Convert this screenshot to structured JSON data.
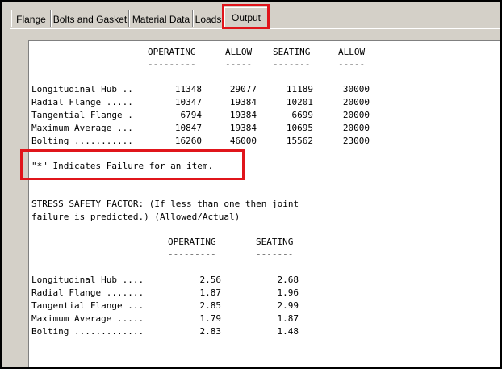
{
  "tabs": [
    {
      "label": "Flange",
      "active": false
    },
    {
      "label": "Bolts and Gasket",
      "active": false
    },
    {
      "label": "Material Data",
      "active": false
    },
    {
      "label": "Loads",
      "active": false
    },
    {
      "label": "Output",
      "active": true
    }
  ],
  "stress_table": {
    "headers": {
      "operating": "OPERATING",
      "allow1": "ALLOW",
      "seating": "SEATING",
      "allow2": "ALLOW"
    },
    "underlines": {
      "operating": "---------",
      "allow1": "-----",
      "seating": "-------",
      "allow2": "-----"
    },
    "rows": [
      {
        "label": "Longitudinal Hub ..",
        "operating": "11348",
        "allow1": "29077",
        "seating": "11189",
        "allow2": "30000"
      },
      {
        "label": "Radial Flange .....",
        "operating": "10347",
        "allow1": "19384",
        "seating": "10201",
        "allow2": "20000"
      },
      {
        "label": "Tangential Flange .",
        "operating": "6794",
        "allow1": "19384",
        "seating": "6699",
        "allow2": "20000"
      },
      {
        "label": "Maximum Average ...",
        "operating": "10847",
        "allow1": "19384",
        "seating": "10695",
        "allow2": "20000"
      },
      {
        "label": "Bolting ...........",
        "operating": "16260",
        "allow1": "46000",
        "seating": "15562",
        "allow2": "23000"
      }
    ]
  },
  "failure_note": "\"*\" Indicates Failure for an item.",
  "safety": {
    "line1": "STRESS SAFETY FACTOR: (If less than one then joint",
    "line2": "failure is predicted.) (Allowed/Actual)",
    "headers": {
      "operating": "OPERATING",
      "seating": "SEATING"
    },
    "underlines": {
      "operating": "---------",
      "seating": "-------"
    },
    "rows": [
      {
        "label": "Longitudinal Hub ....",
        "operating": "2.56",
        "seating": "2.68"
      },
      {
        "label": "Radial Flange .......",
        "operating": "1.87",
        "seating": "1.96"
      },
      {
        "label": "Tangential Flange ...",
        "operating": "2.85",
        "seating": "2.99"
      },
      {
        "label": "Maximum Average .....",
        "operating": "1.79",
        "seating": "1.87"
      },
      {
        "label": "Bolting .............",
        "operating": "2.83",
        "seating": "1.48"
      }
    ]
  },
  "colors": {
    "highlight": "#e0151b",
    "window_bg": "#d4d0c8",
    "output_bg": "#ffffff"
  }
}
